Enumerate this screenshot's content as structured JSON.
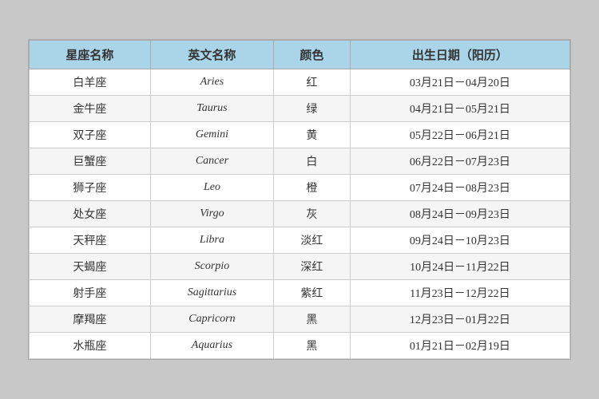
{
  "table": {
    "headers": [
      "星座名称",
      "英文名称",
      "颜色",
      "出生日期（阳历）"
    ],
    "rows": [
      [
        "白羊座",
        "Aries",
        "红",
        "03月21日－04月20日"
      ],
      [
        "金牛座",
        "Taurus",
        "绿",
        "04月21日－05月21日"
      ],
      [
        "双子座",
        "Gemini",
        "黄",
        "05月22日－06月21日"
      ],
      [
        "巨蟹座",
        "Cancer",
        "白",
        "06月22日－07月23日"
      ],
      [
        "狮子座",
        "Leo",
        "橙",
        "07月24日－08月23日"
      ],
      [
        "处女座",
        "Virgo",
        "灰",
        "08月24日－09月23日"
      ],
      [
        "天秤座",
        "Libra",
        "淡红",
        "09月24日－10月23日"
      ],
      [
        "天蝎座",
        "Scorpio",
        "深红",
        "10月24日－11月22日"
      ],
      [
        "射手座",
        "Sagittarius",
        "紫红",
        "11月23日－12月22日"
      ],
      [
        "摩羯座",
        "Capricorn",
        "黑",
        "12月23日－01月22日"
      ],
      [
        "水瓶座",
        "Aquarius",
        "黑",
        "01月21日－02月19日"
      ]
    ]
  }
}
